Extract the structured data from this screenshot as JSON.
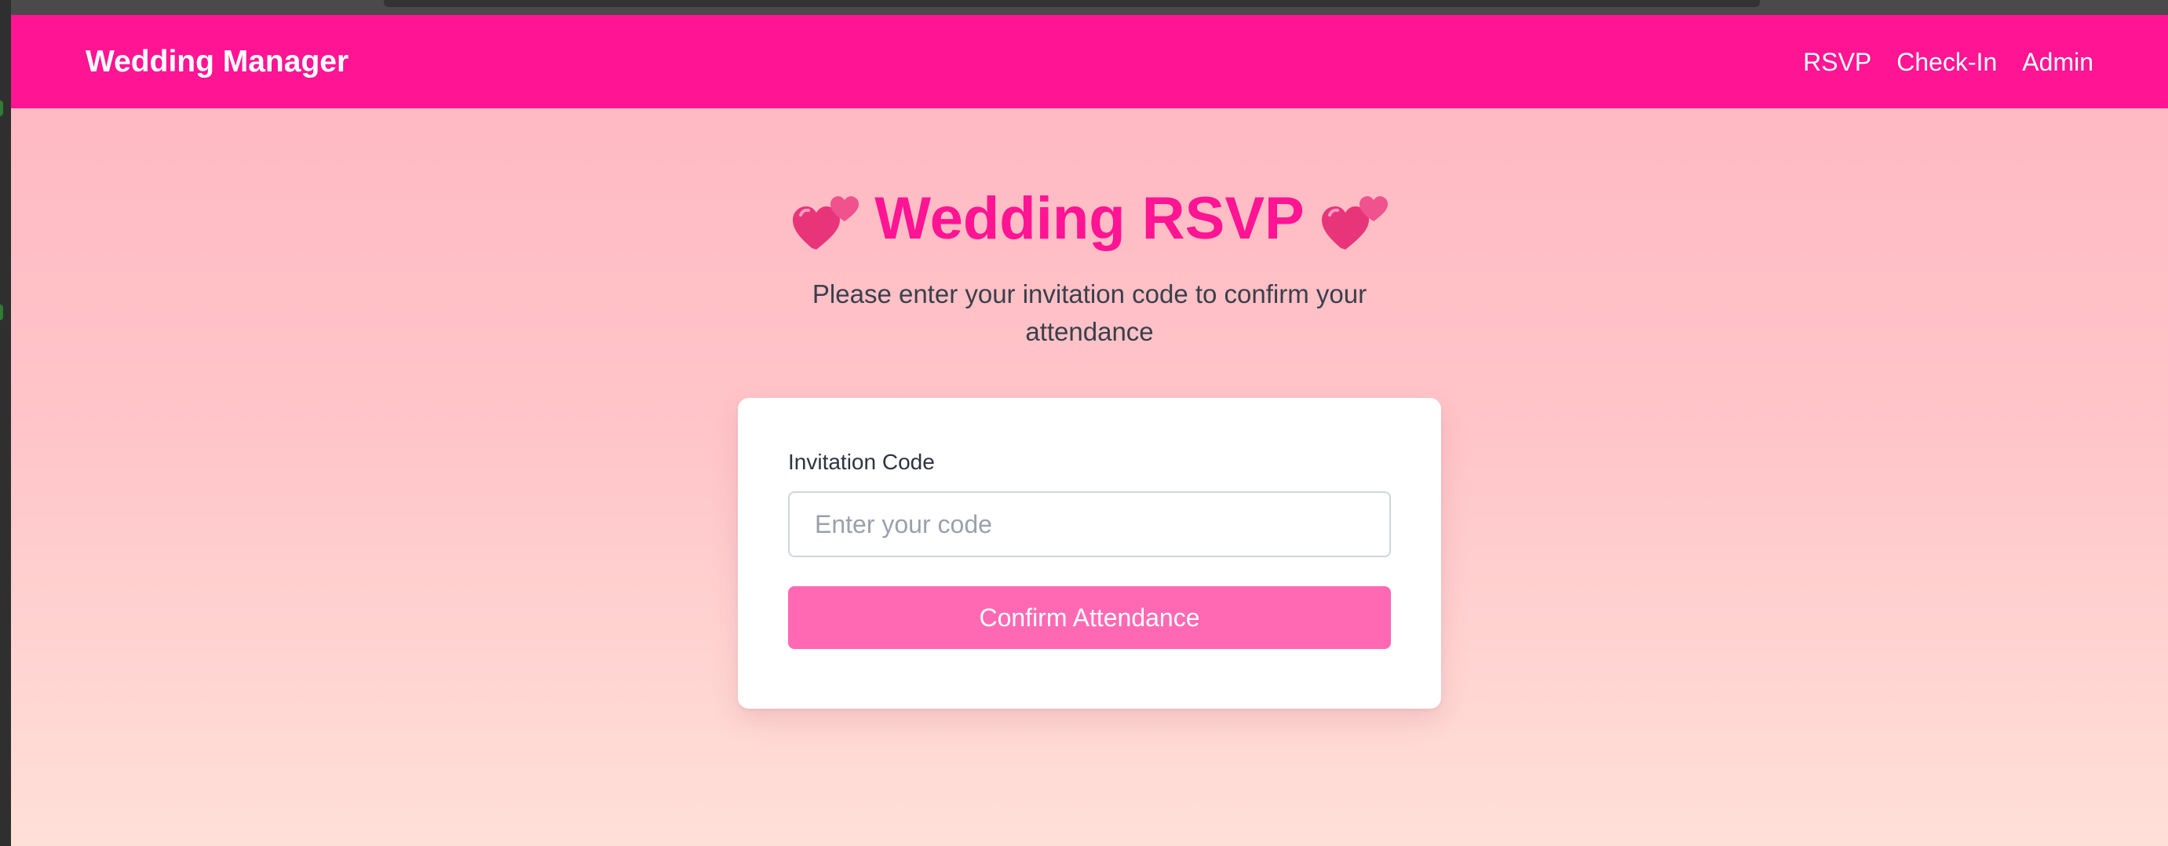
{
  "nav": {
    "brand": "Wedding Manager",
    "links": [
      "RSVP",
      "Check-In",
      "Admin"
    ]
  },
  "hero": {
    "title": "Wedding RSVP",
    "left_icon": "two-hearts-icon",
    "right_icon": "two-hearts-icon",
    "subtitle": "Please enter your invitation code to confirm your attendance"
  },
  "form": {
    "label": "Invitation Code",
    "input_value": "",
    "input_placeholder": "Enter your code",
    "button_label": "Confirm Attendance"
  },
  "colors": {
    "brand_pink": "#ff1493",
    "button_pink": "#ff69b4",
    "background_top": "#ffb6c1",
    "background_bottom": "#ffe0d8"
  }
}
